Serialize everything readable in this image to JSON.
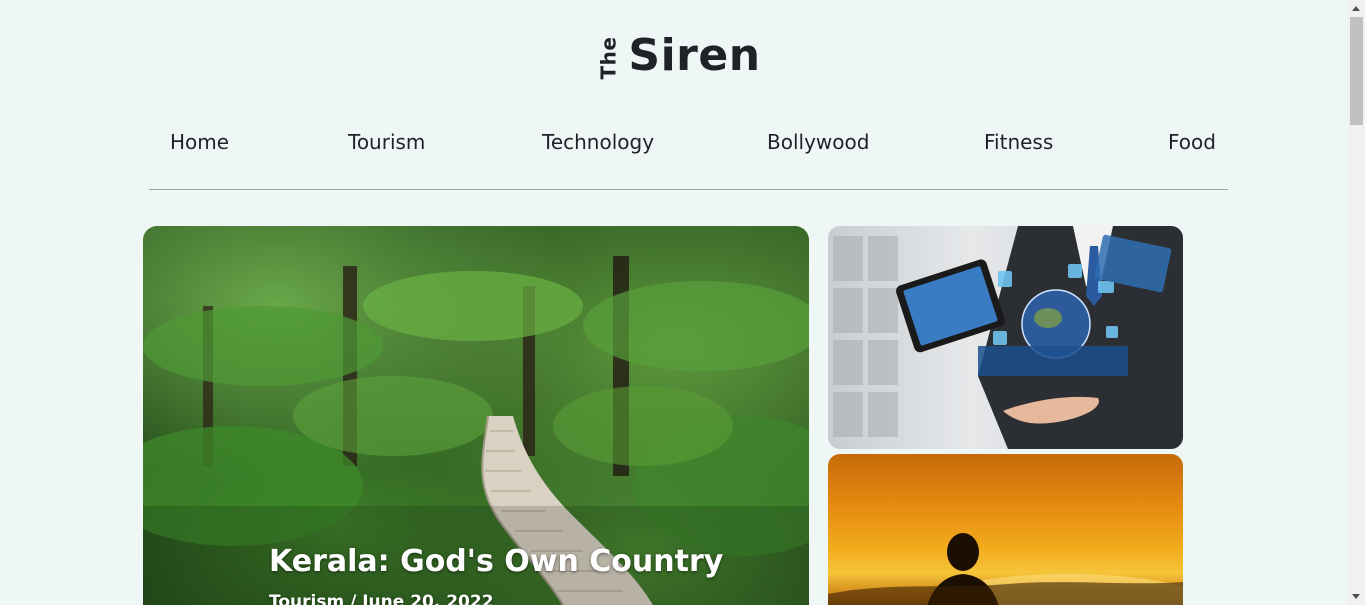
{
  "brand": {
    "prefix": "The",
    "name": "Siren"
  },
  "nav": {
    "items": [
      {
        "label": "Home"
      },
      {
        "label": "Tourism"
      },
      {
        "label": "Technology"
      },
      {
        "label": "Bollywood"
      },
      {
        "label": "Fitness"
      },
      {
        "label": "Food"
      }
    ]
  },
  "featured": {
    "title": "Kerala: God's Own Country",
    "meta": "Tourism / June 20, 2022"
  },
  "colors": {
    "background": "#eff6f6",
    "text": "#1f2328",
    "divider": "#9aa3a6"
  }
}
